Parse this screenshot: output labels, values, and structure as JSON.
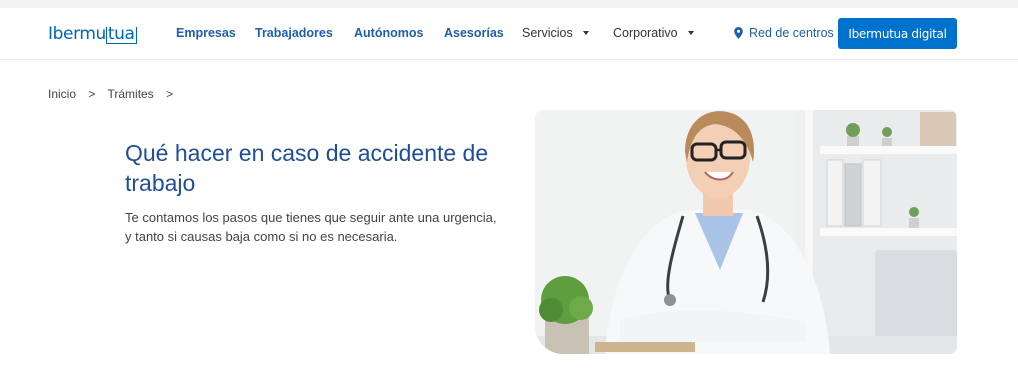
{
  "header": {
    "logo_text_a": "Ibermu",
    "logo_text_b": "tua",
    "nav": [
      {
        "label": "Empresas"
      },
      {
        "label": "Trabajadores"
      },
      {
        "label": "Autónomos"
      },
      {
        "label": "Asesorías"
      },
      {
        "label": "Servicios"
      },
      {
        "label": "Corporativo"
      }
    ],
    "red_centros": "Red de centros",
    "digital_button": "Ibermutua digital"
  },
  "breadcrumb": {
    "items": [
      "Inicio",
      "Trámites"
    ],
    "separator": ">"
  },
  "hero": {
    "title": "Qué hacer en caso de accidente de trabajo",
    "description": "Te contamos los pasos que tienes que seguir ante una urgencia, y tanto si causas baja como si no es necesaria."
  },
  "colors": {
    "brand": "#0066b3",
    "button": "#0072ce",
    "title": "#1f4e96"
  },
  "icons": {
    "location": "map-pin-icon"
  }
}
